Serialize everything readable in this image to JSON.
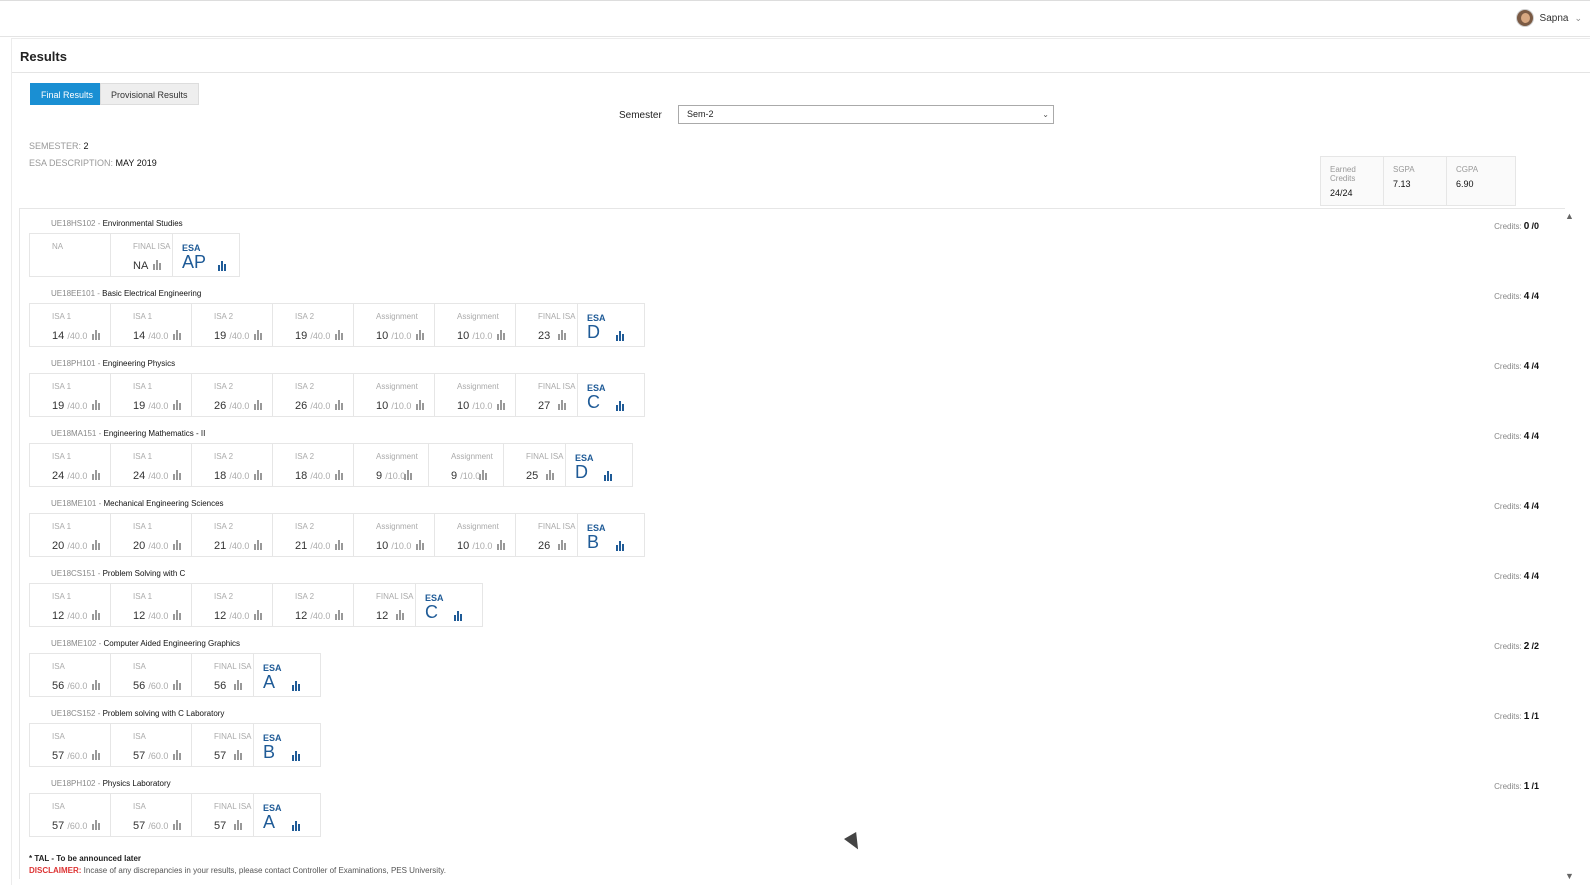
{
  "user": {
    "name": "Sapna"
  },
  "page": {
    "title": "Results"
  },
  "tabs": {
    "final": "Final Results",
    "provisional": "Provisional Results"
  },
  "filter": {
    "label": "Semester",
    "value": "Sem-2"
  },
  "meta": {
    "semester_label": "SEMESTER:",
    "semester_value": "2",
    "esa_label": "ESA DESCRIPTION:",
    "esa_value": "MAY 2019"
  },
  "summary": {
    "earned_label": "Earned Credits",
    "earned_value": "24/24",
    "sgpa_label": "SGPA",
    "sgpa_value": "7.13",
    "cgpa_label": "CGPA",
    "cgpa_value": "6.90"
  },
  "credits_label": "Credits:",
  "courses": [
    {
      "code": "UE18HS102 -",
      "name": "Environmental Studies",
      "credits": "0",
      "credits_total": "/0",
      "cells": [
        {
          "label": "NA",
          "na": true
        },
        {
          "label": "FINAL ISA",
          "value": "NA",
          "fin": true
        },
        {
          "label": "ESA",
          "grade": "AP",
          "esa": true
        }
      ]
    },
    {
      "code": "UE18EE101 -",
      "name": "Basic Electrical Engineering",
      "credits": "4",
      "credits_total": "/4",
      "cells": [
        {
          "label": "ISA 1",
          "value": "14",
          "total": "/40.0"
        },
        {
          "label": "ISA 1",
          "value": "14",
          "total": "/40.0"
        },
        {
          "label": "ISA 2",
          "value": "19",
          "total": "/40.0"
        },
        {
          "label": "ISA 2",
          "value": "19",
          "total": "/40.0"
        },
        {
          "label": "Assignment",
          "value": "10",
          "total": "/10.0"
        },
        {
          "label": "Assignment",
          "value": "10",
          "total": "/10.0"
        },
        {
          "label": "FINAL ISA",
          "value": "23",
          "fin": true
        },
        {
          "label": "ESA",
          "grade": "D",
          "esa": true
        }
      ]
    },
    {
      "code": "UE18PH101 -",
      "name": "Engineering Physics",
      "credits": "4",
      "credits_total": "/4",
      "cells": [
        {
          "label": "ISA 1",
          "value": "19",
          "total": "/40.0"
        },
        {
          "label": "ISA 1",
          "value": "19",
          "total": "/40.0"
        },
        {
          "label": "ISA 2",
          "value": "26",
          "total": "/40.0"
        },
        {
          "label": "ISA 2",
          "value": "26",
          "total": "/40.0"
        },
        {
          "label": "Assignment",
          "value": "10",
          "total": "/10.0"
        },
        {
          "label": "Assignment",
          "value": "10",
          "total": "/10.0"
        },
        {
          "label": "FINAL ISA",
          "value": "27",
          "fin": true
        },
        {
          "label": "ESA",
          "grade": "C",
          "esa": true
        }
      ]
    },
    {
      "code": "UE18MA151 -",
      "name": "Engineering Mathematics - II",
      "credits": "4",
      "credits_total": "/4",
      "cells": [
        {
          "label": "ISA 1",
          "value": "24",
          "total": "/40.0"
        },
        {
          "label": "ISA 1",
          "value": "24",
          "total": "/40.0"
        },
        {
          "label": "ISA 2",
          "value": "18",
          "total": "/40.0"
        },
        {
          "label": "ISA 2",
          "value": "18",
          "total": "/40.0"
        },
        {
          "label": "Assignment",
          "value": "9",
          "total": "/10.0",
          "narrow": true
        },
        {
          "label": "Assignment",
          "value": "9",
          "total": "/10.0",
          "narrow": true
        },
        {
          "label": "FINAL ISA",
          "value": "25",
          "fin": true
        },
        {
          "label": "ESA",
          "grade": "D",
          "esa": true
        }
      ]
    },
    {
      "code": "UE18ME101 -",
      "name": "Mechanical Engineering Sciences",
      "credits": "4",
      "credits_total": "/4",
      "cells": [
        {
          "label": "ISA 1",
          "value": "20",
          "total": "/40.0"
        },
        {
          "label": "ISA 1",
          "value": "20",
          "total": "/40.0"
        },
        {
          "label": "ISA 2",
          "value": "21",
          "total": "/40.0"
        },
        {
          "label": "ISA 2",
          "value": "21",
          "total": "/40.0"
        },
        {
          "label": "Assignment",
          "value": "10",
          "total": "/10.0"
        },
        {
          "label": "Assignment",
          "value": "10",
          "total": "/10.0"
        },
        {
          "label": "FINAL ISA",
          "value": "26",
          "fin": true
        },
        {
          "label": "ESA",
          "grade": "B",
          "esa": true
        }
      ]
    },
    {
      "code": "UE18CS151 -",
      "name": "Problem Solving with C",
      "credits": "4",
      "credits_total": "/4",
      "cells": [
        {
          "label": "ISA 1",
          "value": "12",
          "total": "/40.0"
        },
        {
          "label": "ISA 1",
          "value": "12",
          "total": "/40.0"
        },
        {
          "label": "ISA 2",
          "value": "12",
          "total": "/40.0"
        },
        {
          "label": "ISA 2",
          "value": "12",
          "total": "/40.0"
        },
        {
          "label": "FINAL ISA",
          "value": "12",
          "fin": true
        },
        {
          "label": "ESA",
          "grade": "C",
          "esa": true
        }
      ]
    },
    {
      "code": "UE18ME102 -",
      "name": "Computer Aided Engineering Graphics",
      "credits": "2",
      "credits_total": "/2",
      "cells": [
        {
          "label": "ISA",
          "value": "56",
          "total": "/60.0"
        },
        {
          "label": "ISA",
          "value": "56",
          "total": "/60.0"
        },
        {
          "label": "FINAL ISA",
          "value": "56",
          "fin": true
        },
        {
          "label": "ESA",
          "grade": "A",
          "esa": true
        }
      ]
    },
    {
      "code": "UE18CS152 -",
      "name": "Problem solving with C Laboratory",
      "credits": "1",
      "credits_total": "/1",
      "cells": [
        {
          "label": "ISA",
          "value": "57",
          "total": "/60.0"
        },
        {
          "label": "ISA",
          "value": "57",
          "total": "/60.0"
        },
        {
          "label": "FINAL ISA",
          "value": "57",
          "fin": true
        },
        {
          "label": "ESA",
          "grade": "B",
          "esa": true
        }
      ]
    },
    {
      "code": "UE18PH102 -",
      "name": "Physics Laboratory",
      "credits": "1",
      "credits_total": "/1",
      "cells": [
        {
          "label": "ISA",
          "value": "57",
          "total": "/60.0"
        },
        {
          "label": "ISA",
          "value": "57",
          "total": "/60.0"
        },
        {
          "label": "FINAL ISA",
          "value": "57",
          "fin": true
        },
        {
          "label": "ESA",
          "grade": "A",
          "esa": true
        }
      ]
    }
  ],
  "footer": {
    "note": "* TAL - To be announced later",
    "disclaimer_label": "DISCLAIMER:",
    "disclaimer_text": " Incase of any discrepancies in your results, please contact Controller of Examinations, PES University."
  },
  "icons": {
    "chart": "bar-chart-icon",
    "dropdown": "chevron-down-icon"
  },
  "colors": {
    "accent": "#1a8fd3",
    "grade": "#1f5b97",
    "disclaimer": "#dd3333"
  }
}
